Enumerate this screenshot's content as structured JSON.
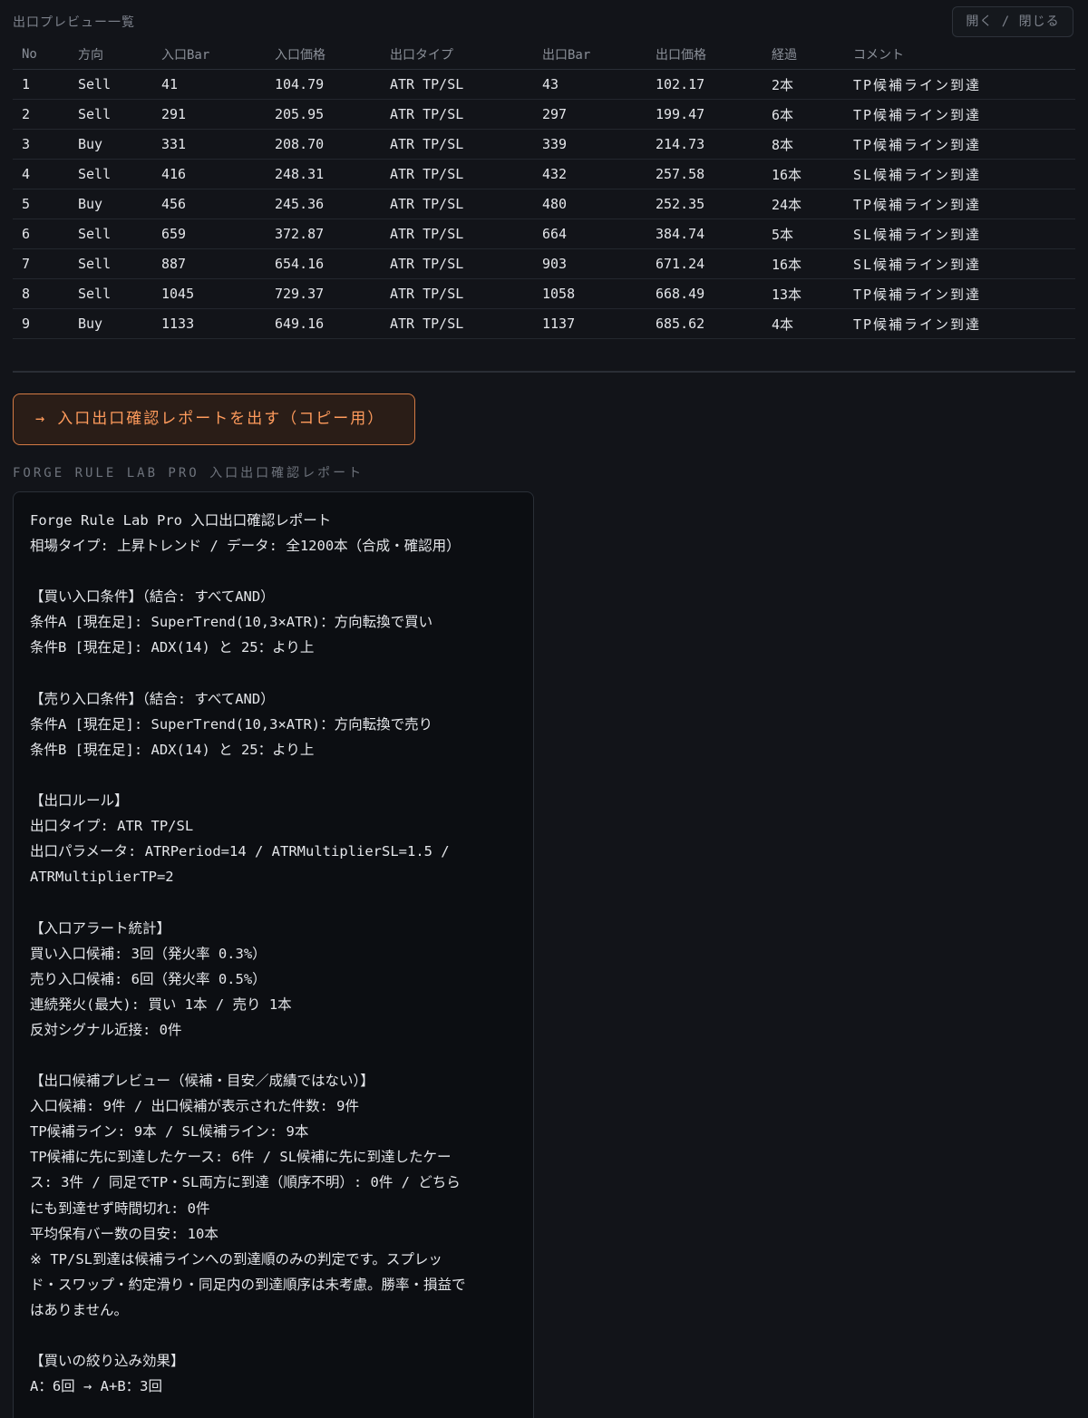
{
  "panel": {
    "title": "出口プレビュー一覧",
    "toggle_label": "開く / 閉じる"
  },
  "table": {
    "columns": [
      "No",
      "方向",
      "入口Bar",
      "入口価格",
      "出口タイプ",
      "出口Bar",
      "出口価格",
      "経過",
      "コメント"
    ],
    "rows": [
      {
        "no": "1",
        "dir": "Sell",
        "entry_bar": "41",
        "entry_price": "104.79",
        "exit_type": "ATR TP/SL",
        "exit_bar": "43",
        "exit_price": "102.17",
        "elapsed": "2本",
        "comment": "TP候補ライン到達"
      },
      {
        "no": "2",
        "dir": "Sell",
        "entry_bar": "291",
        "entry_price": "205.95",
        "exit_type": "ATR TP/SL",
        "exit_bar": "297",
        "exit_price": "199.47",
        "elapsed": "6本",
        "comment": "TP候補ライン到達"
      },
      {
        "no": "3",
        "dir": "Buy",
        "entry_bar": "331",
        "entry_price": "208.70",
        "exit_type": "ATR TP/SL",
        "exit_bar": "339",
        "exit_price": "214.73",
        "elapsed": "8本",
        "comment": "TP候補ライン到達"
      },
      {
        "no": "4",
        "dir": "Sell",
        "entry_bar": "416",
        "entry_price": "248.31",
        "exit_type": "ATR TP/SL",
        "exit_bar": "432",
        "exit_price": "257.58",
        "elapsed": "16本",
        "comment": "SL候補ライン到達"
      },
      {
        "no": "5",
        "dir": "Buy",
        "entry_bar": "456",
        "entry_price": "245.36",
        "exit_type": "ATR TP/SL",
        "exit_bar": "480",
        "exit_price": "252.35",
        "elapsed": "24本",
        "comment": "TP候補ライン到達"
      },
      {
        "no": "6",
        "dir": "Sell",
        "entry_bar": "659",
        "entry_price": "372.87",
        "exit_type": "ATR TP/SL",
        "exit_bar": "664",
        "exit_price": "384.74",
        "elapsed": "5本",
        "comment": "SL候補ライン到達"
      },
      {
        "no": "7",
        "dir": "Sell",
        "entry_bar": "887",
        "entry_price": "654.16",
        "exit_type": "ATR TP/SL",
        "exit_bar": "903",
        "exit_price": "671.24",
        "elapsed": "16本",
        "comment": "SL候補ライン到達"
      },
      {
        "no": "8",
        "dir": "Sell",
        "entry_bar": "1045",
        "entry_price": "729.37",
        "exit_type": "ATR TP/SL",
        "exit_bar": "1058",
        "exit_price": "668.49",
        "elapsed": "13本",
        "comment": "TP候補ライン到達"
      },
      {
        "no": "9",
        "dir": "Buy",
        "entry_bar": "1133",
        "entry_price": "649.16",
        "exit_type": "ATR TP/SL",
        "exit_bar": "1137",
        "exit_price": "685.62",
        "elapsed": "4本",
        "comment": "TP候補ライン到達"
      }
    ]
  },
  "report_button": {
    "arrow": "→",
    "label": "入口出口確認レポートを出す（コピー用）"
  },
  "report": {
    "label": "FORGE RULE LAB PRO 入口出口確認レポート",
    "lines": [
      "Forge Rule Lab Pro 入口出口確認レポート",
      "相場タイプ: 上昇トレンド / データ: 全1200本（合成・確認用）",
      "",
      "【買い入口条件】（結合: すべてAND）",
      "条件A [現在足]: SuperTrend(10,3×ATR)：方向転換で買い",
      "条件B [現在足]: ADX(14) と 25：より上",
      "",
      "【売り入口条件】（結合: すべてAND）",
      "条件A [現在足]: SuperTrend(10,3×ATR)：方向転換で売り",
      "条件B [現在足]: ADX(14) と 25：より上",
      "",
      "【出口ルール】",
      "出口タイプ: ATR TP/SL",
      "出口パラメータ: ATRPeriod=14 / ATRMultiplierSL=1.5 /",
      "ATRMultiplierTP=2",
      "",
      "【入口アラート統計】",
      "買い入口候補: 3回（発火率 0.3%）",
      "売り入口候補: 6回（発火率 0.5%）",
      "連続発火(最大): 買い 1本 / 売り 1本",
      "反対シグナル近接: 0件",
      "",
      "【出口候補プレビュー（候補・目安／成績ではない）】",
      "入口候補: 9件 / 出口候補が表示された件数: 9件",
      "TP候補ライン: 9本 / SL候補ライン: 9本",
      "TP候補に先に到達したケース: 6件 / SL候補に先に到達したケー",
      "ス: 3件 / 同足でTP・SL両方に到達（順序不明）: 0件 / どちら",
      "にも到達せず時間切れ: 0件",
      "平均保有バー数の目安: 10本",
      "※ TP/SL到達は候補ラインへの到達順のみの判定です。スプレッ",
      "ド・スワップ・約定滑り・同足内の到達順序は未考慮。勝率・損益で",
      "はありません。",
      "",
      "【買いの絞り込み効果】",
      "A：6回 → A+B：3回"
    ]
  },
  "colors": {
    "background": "#121419",
    "sell": "#e36b74",
    "buy": "#4fb37f",
    "accent": "#ff9b5c"
  }
}
